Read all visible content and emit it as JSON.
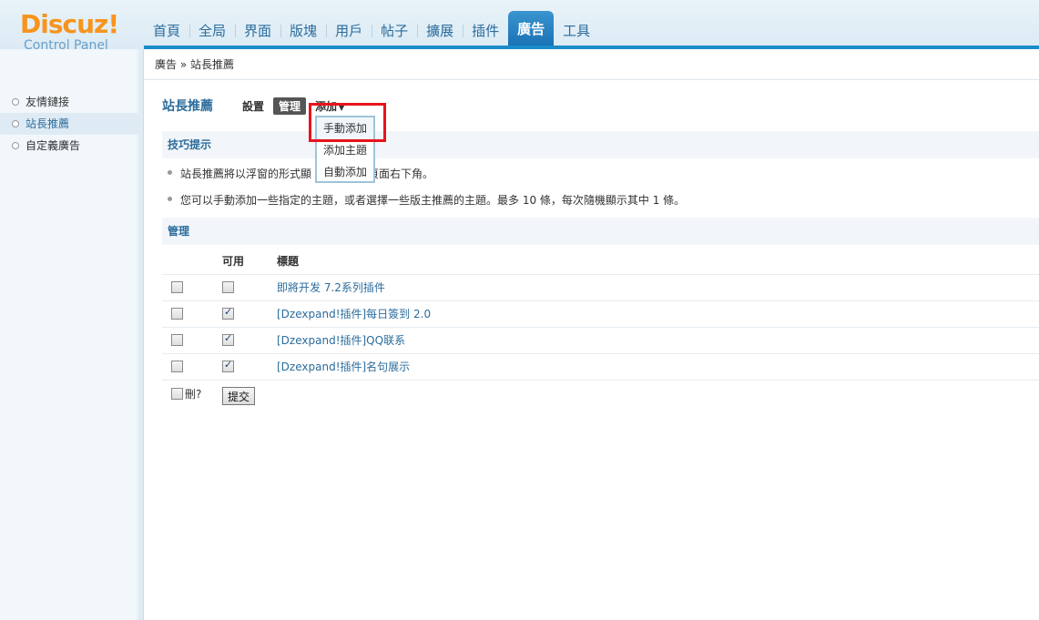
{
  "logo": {
    "brand": "Discuz!",
    "sub": "Control Panel"
  },
  "topnav": [
    "首頁",
    "全局",
    "界面",
    "版塊",
    "用戶",
    "帖子",
    "擴展",
    "插件",
    "廣告",
    "工具"
  ],
  "breadcrumb": {
    "parent": "廣告",
    "sep": "»",
    "current": "站長推薦"
  },
  "sidebar": {
    "items": [
      "友情鏈接",
      "站長推薦",
      "自定義廣告"
    ]
  },
  "page": {
    "title": "站長推薦",
    "tabs": {
      "settings": "設置",
      "manage": "管理",
      "add": "添加"
    }
  },
  "dropdown": {
    "items": [
      "手動添加",
      "添加主題",
      "自動添加"
    ]
  },
  "tips": {
    "title": "技巧提示",
    "line1_a": "站長推薦將以浮窗的形式顯",
    "line1_b": "頁面右下角。",
    "line2": "您可以手動添加一些指定的主題，或者選擇一些版主推薦的主題。最多 10 條，每次隨機顯示其中 1 條。"
  },
  "manage": {
    "title": "管理",
    "headers": {
      "enabled": "可用",
      "subject": "標題"
    },
    "rows": [
      {
        "subject": "即將开发 7.2系列插件",
        "enabled": false
      },
      {
        "subject": "[Dzexpand!插件]每日簽到 2.0",
        "enabled": true
      },
      {
        "subject": "[Dzexpand!插件]QQ联系",
        "enabled": true
      },
      {
        "subject": "[Dzexpand!插件]名句展示",
        "enabled": true
      }
    ],
    "delete_label": "刪?",
    "submit_label": "提交"
  },
  "colors": {
    "accent": "#2b6c9c",
    "logo": "#f7941d",
    "highlight": "#e8141c",
    "active_tab": "#1a73b5"
  }
}
